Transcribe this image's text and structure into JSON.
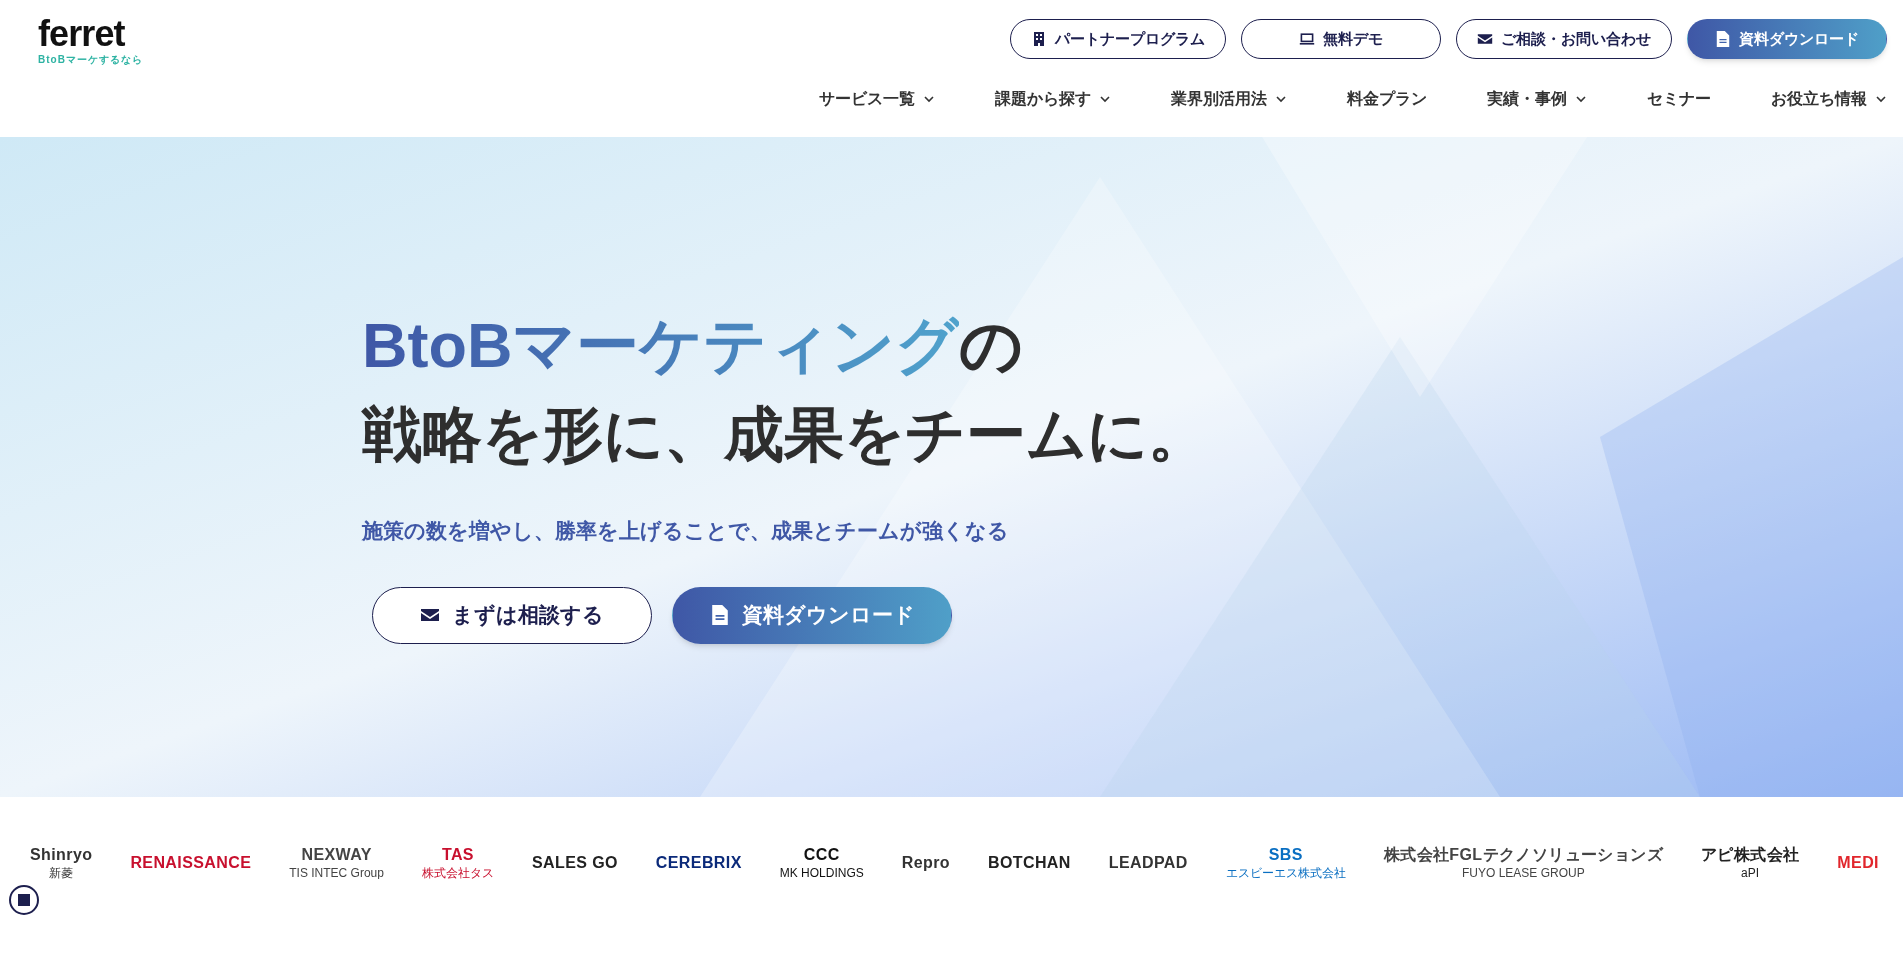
{
  "logo": {
    "wordmark": "ferret",
    "tagline": "BtoBマーケするなら"
  },
  "top_buttons": [
    {
      "label": "パートナープログラム",
      "kind": "partner"
    },
    {
      "label": "無料デモ",
      "kind": "demo"
    },
    {
      "label": "ご相談・お問い合わせ",
      "kind": "contact"
    },
    {
      "label": "資料ダウンロード",
      "kind": "download"
    }
  ],
  "nav": [
    {
      "label": "サービス一覧",
      "has_menu": true
    },
    {
      "label": "課題から探す",
      "has_menu": true
    },
    {
      "label": "業界別活用法",
      "has_menu": true
    },
    {
      "label": "料金プラン",
      "has_menu": false
    },
    {
      "label": "実績・事例",
      "has_menu": true
    },
    {
      "label": "セミナー",
      "has_menu": false
    },
    {
      "label": "お役立ち情報",
      "has_menu": true
    }
  ],
  "hero": {
    "heading_highlight": "BtoBマーケティング",
    "heading_rest": "の",
    "heading_line2": "戦略を形に、成果をチームに。",
    "subtitle": "施策の数を増やし、勝率を上げることで、成果とチームが強くなる",
    "buttons": [
      {
        "label": "まずは相談する",
        "kind": "contact"
      },
      {
        "label": "資料ダウンロード",
        "kind": "download"
      }
    ]
  },
  "logos": [
    {
      "text": "Shinryo",
      "sub": "新菱",
      "color": "#333333"
    },
    {
      "text": "RENAISSANCE",
      "color": "#c8102e"
    },
    {
      "text": "NEXWAY",
      "sub": "TIS INTEC Group",
      "color": "#444444"
    },
    {
      "text": "TAS",
      "sub": "株式会社タス",
      "color": "#c8102e"
    },
    {
      "text": "SALES GO",
      "color": "#222222"
    },
    {
      "text": "CEREBRIX",
      "color": "#0b2a7a"
    },
    {
      "text": "CCC",
      "sub": "MK HOLDINGS",
      "color": "#111111"
    },
    {
      "text": "Repro",
      "color": "#333333"
    },
    {
      "text": "BOTCHAN",
      "color": "#222222"
    },
    {
      "text": "LEADPAD",
      "color": "#333333"
    },
    {
      "text": "SBS",
      "sub": "エスビーエス株式会社",
      "color": "#0a6fc2"
    },
    {
      "text": "株式会社FGLテクノソリューションズ",
      "sub": "FUYO LEASE GROUP",
      "color": "#444444"
    },
    {
      "text": "アピ株式会社",
      "sub": "aPI",
      "color": "#222222"
    },
    {
      "text": "MEDI",
      "color": "#e1262c"
    }
  ]
}
